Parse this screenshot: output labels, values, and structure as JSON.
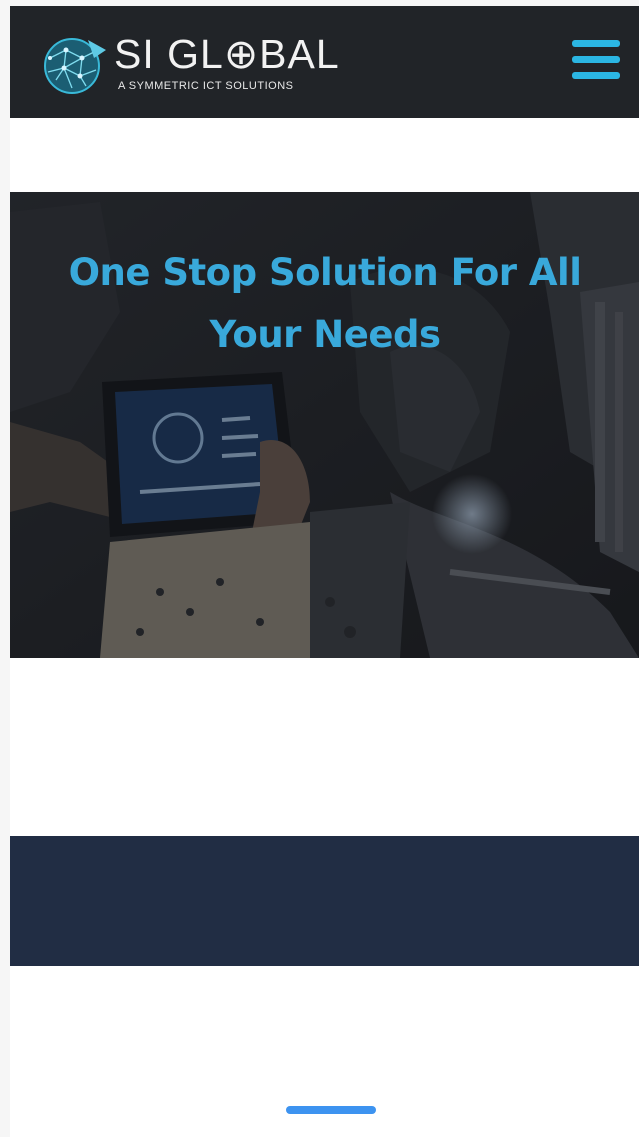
{
  "header": {
    "logo_name": "SI GL⊕BAL",
    "logo_tagline": "A SYMMETRIC ICT SOLUTIONS"
  },
  "hero": {
    "title": "One Stop Solution For All Your Needs"
  },
  "colors": {
    "navbar_bg": "#212428",
    "accent": "#2bb6e3",
    "hero_title": "#39a9db",
    "band_bg": "#212d44",
    "indicator": "#3d93f0"
  },
  "icons": {
    "logo": "globe-network-icon",
    "menu": "hamburger-menu-icon"
  }
}
